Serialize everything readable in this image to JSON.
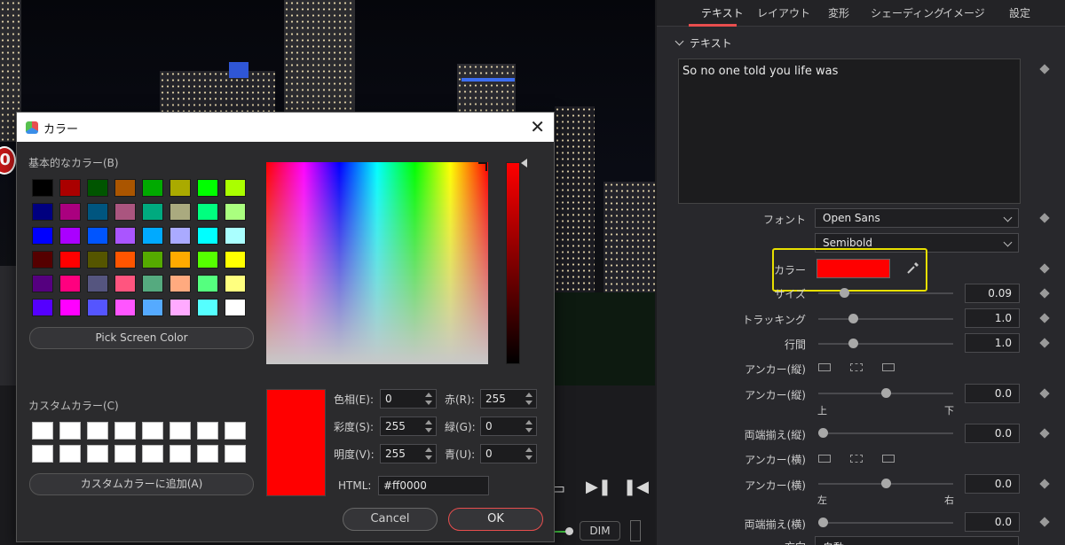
{
  "inspector": {
    "tabs": [
      "テキスト",
      "レイアウト",
      "変形",
      "シェーディング",
      "イメージ",
      "設定"
    ],
    "section_title": "テキスト",
    "text_value": "So no one told you life was",
    "font_label": "フォント",
    "font_value": "Open Sans",
    "style_value": "Semibold",
    "color_label": "カラー",
    "color_value": "#ff0000",
    "size_label": "サイズ",
    "size_value": "0.09",
    "tracking_label": "トラッキング",
    "tracking_value": "1.0",
    "linespacing_label": "行間",
    "linespacing_value": "1.0",
    "anchor_v_label": "アンカー(縦)",
    "anchor_v2_label": "アンカー(縦)",
    "anchor_v2_value": "0.0",
    "top_label": "上",
    "bottom_label": "下",
    "justify_v_label": "両端揃え(縦)",
    "justify_v_value": "0.0",
    "anchor_h_label": "アンカー(横)",
    "anchor_h2_label": "アンカー(横)",
    "anchor_h2_value": "0.0",
    "left_label": "左",
    "right_label": "右",
    "justify_h_label": "両端揃え(横)",
    "justify_h_value": "0.0",
    "direction_label": "方向",
    "direction_value": "自動"
  },
  "viewer": {
    "badge": "0",
    "dim_label": "DIM"
  },
  "dialog": {
    "title": "カラー",
    "basic_label": "基本的なカラー(B)",
    "basic_colors": [
      "#000000",
      "#aa0000",
      "#005500",
      "#aa5500",
      "#00aa00",
      "#aaaa00",
      "#00ff00",
      "#aaff00",
      "#00007f",
      "#aa007f",
      "#00557f",
      "#aa557f",
      "#00aa7f",
      "#aaaa7f",
      "#00ff7f",
      "#aaff7f",
      "#0000ff",
      "#aa00ff",
      "#0055ff",
      "#aa55ff",
      "#00aaff",
      "#aaaaff",
      "#00ffff",
      "#aaffff",
      "#550000",
      "#ff0000",
      "#555500",
      "#ff5500",
      "#55aa00",
      "#ffaa00",
      "#55ff00",
      "#ffff00",
      "#55007f",
      "#ff007f",
      "#55557f",
      "#ff557f",
      "#55aa7f",
      "#ffaa7f",
      "#55ff7f",
      "#ffff7f",
      "#5500ff",
      "#ff00ff",
      "#5555ff",
      "#ff55ff",
      "#55aaff",
      "#ffaaff",
      "#55ffff",
      "#ffffff"
    ],
    "pick_screen_label": "Pick Screen Color",
    "custom_label": "カスタムカラー(C)",
    "add_custom_label": "カスタムカラーに追加(A)",
    "hue_label": "色相(E):",
    "hue_value": "0",
    "sat_label": "彩度(S):",
    "sat_value": "255",
    "val_label": "明度(V):",
    "val_value": "255",
    "red_label": "赤(R):",
    "red_value": "255",
    "green_label": "緑(G):",
    "green_value": "0",
    "blue_label": "青(U):",
    "blue_value": "0",
    "html_label": "HTML:",
    "html_value": "#ff0000",
    "cancel_label": "Cancel",
    "ok_label": "OK"
  }
}
